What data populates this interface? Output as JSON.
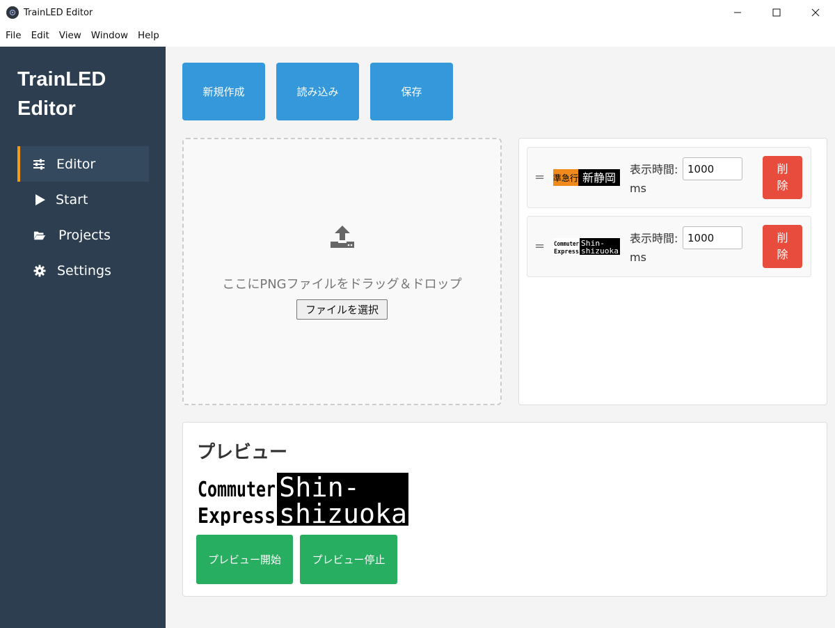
{
  "window": {
    "title": "TrainLED Editor"
  },
  "menu": [
    "File",
    "Edit",
    "View",
    "Window",
    "Help"
  ],
  "sidebar": {
    "logo_line1": "TrainLED",
    "logo_line2": "Editor",
    "items": [
      {
        "label": "Editor",
        "icon": "sliders-icon",
        "active": true
      },
      {
        "label": "Start",
        "icon": "play-icon",
        "active": false
      },
      {
        "label": "Projects",
        "icon": "folder-open-icon",
        "active": false
      },
      {
        "label": "Settings",
        "icon": "gear-icon",
        "active": false
      }
    ]
  },
  "toolbar": {
    "new_label": "新規作成",
    "load_label": "読み込み",
    "save_label": "保存"
  },
  "dropzone": {
    "text": "ここにPNGファイルをドラッグ＆ドロップ",
    "button_label": "ファイルを選択"
  },
  "frames": [
    {
      "handle": "=",
      "thumb_left": "準急行",
      "thumb_right": "新静岡",
      "time_label": "表示時間:",
      "time_value": "1000",
      "unit": "ms",
      "delete_label": "削除"
    },
    {
      "handle": "=",
      "thumb_top": "Commuter",
      "thumb_bottom": "Express",
      "thumb_right_top": "Shin-",
      "thumb_right_bottom": "shizuoka",
      "time_label": "表示時間:",
      "time_value": "1000",
      "unit": "ms",
      "delete_label": "削除"
    }
  ],
  "preview": {
    "title": "プレビュー",
    "image": {
      "left_top": "Commuter",
      "left_bottom": "Express",
      "right_top": "Shin-",
      "right_bottom": "shizuoka"
    },
    "start_label": "プレビュー開始",
    "stop_label": "プレビュー停止"
  },
  "colors": {
    "sidebar": "#2c3e50",
    "accent": "#f39c12",
    "primary": "#3498db",
    "danger": "#e74c3c",
    "success": "#27ae60",
    "led_orange": "#f08a1c"
  }
}
